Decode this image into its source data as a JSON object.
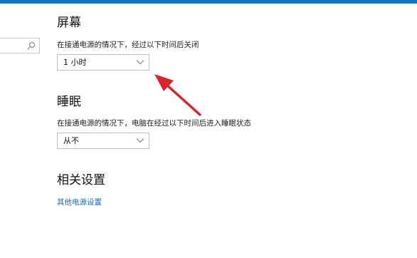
{
  "screen": {
    "title": "屏幕",
    "description": "在接通电源的情况下，经过以下时间后关闭",
    "selected": "1 小时"
  },
  "sleep": {
    "title": "睡眠",
    "description": "在接通电源的情况下，电脑在经过以下时间后进入睡眠状态",
    "selected": "从不"
  },
  "related": {
    "title": "相关设置",
    "link": "其他电源设置"
  },
  "colors": {
    "accent": "#0a73c9",
    "link": "#1a6fb5",
    "annotation_arrow": "#d9252a"
  },
  "icons": {
    "search": "search-icon",
    "dropdown": "chevron-down-icon"
  }
}
